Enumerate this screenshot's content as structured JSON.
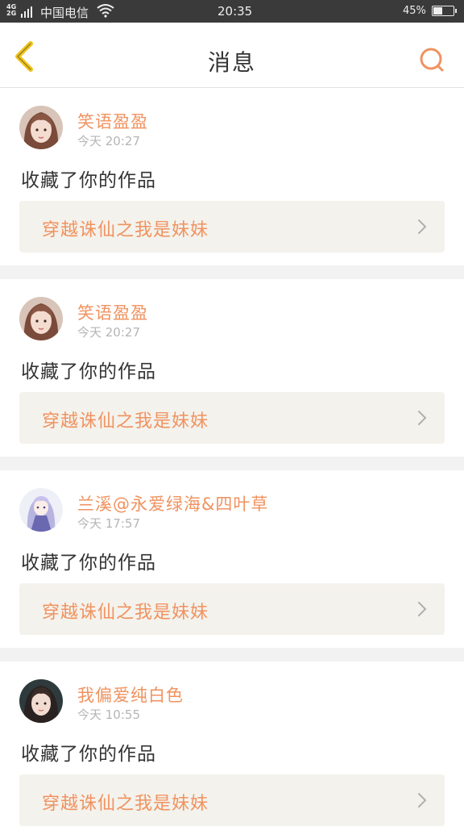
{
  "status_bar": {
    "network": "4G 2G",
    "carrier": "中国电信",
    "time": "20:35",
    "battery": "45%"
  },
  "nav": {
    "title": "消息",
    "back_icon": "chevron-left-icon",
    "search_icon": "search-icon",
    "accent_color": "#f0c419",
    "search_color": "#f0925f"
  },
  "messages": [
    {
      "username": "笑语盈盈",
      "time": "今天 20:27",
      "action": "收藏了你的作品",
      "work_title": "穿越诛仙之我是妹妹",
      "avatar": "girl-avatar"
    },
    {
      "username": "笑语盈盈",
      "time": "今天 20:27",
      "action": "收藏了你的作品",
      "work_title": "穿越诛仙之我是妹妹",
      "avatar": "girl-avatar"
    },
    {
      "username": "兰溪@永爱绿海&四叶草",
      "time": "今天 17:57",
      "action": "收藏了你的作品",
      "work_title": "穿越诛仙之我是妹妹",
      "avatar": "anime-avatar"
    },
    {
      "username": "我偏爱纯白色",
      "time": "今天 10:55",
      "action": "收藏了你的作品",
      "work_title": "穿越诛仙之我是妹妹",
      "avatar": "girl-avatar"
    }
  ]
}
